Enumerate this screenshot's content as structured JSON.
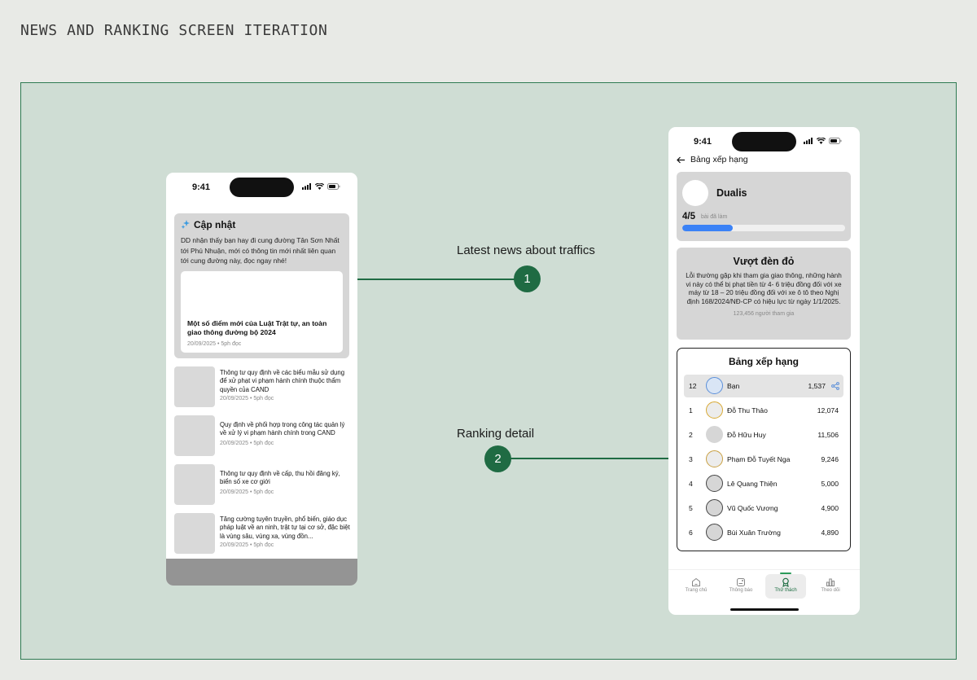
{
  "page_title": "NEWS AND RANKING SCREEN ITERATION",
  "annotations": [
    {
      "number": "1",
      "label": "Latest news about traffics"
    },
    {
      "number": "2",
      "label": "Ranking detail"
    }
  ],
  "news_screen": {
    "status_time": "9:41",
    "update": {
      "icon": "sparkle-icon",
      "title": "Cập nhật",
      "description": "DD nhận thấy bạn hay đi cung đường Tân Sơn Nhất tới Phú Nhuận, mới có thông tin mới nhất liên quan tới cung đường này, đọc ngay nhé!",
      "featured_title": "Một số điểm mới của Luật Trật tự, an toàn giao thông đường bộ 2024",
      "featured_meta": "20/09/2025  •  5ph đọc"
    },
    "news_items": [
      {
        "title": "Thông tư quy định về các biểu mẫu sử dụng để xử phạt vi phạm hành chính thuộc thẩm quyền của CAND",
        "meta": "20/09/2025  •  5ph đọc"
      },
      {
        "title": "Quy định về phối hợp trong công tác quản lý về xử lý vi phạm hành chính trong CAND",
        "meta": "20/09/2025  •  5ph đọc"
      },
      {
        "title": "Thông tư quy định về cấp, thu hồi đăng ký, biển số xe cơ giới",
        "meta": "20/09/2025  •  5ph đọc"
      },
      {
        "title": "Tăng cường tuyên truyền, phổ biến, giáo dục pháp luật về an ninh, trật tự tại cơ sở, đặc biệt là vùng sâu, vùng xa, vùng đồn...",
        "meta": "20/09/2025  •  5ph đọc"
      }
    ]
  },
  "ranking_screen": {
    "status_time": "9:41",
    "back_label": "Bảng xếp hạng",
    "profile": {
      "name": "Dualis",
      "progress_count": "4/5",
      "progress_caption": "bài đã làm",
      "progress_fraction": 0.31
    },
    "challenge": {
      "title": "Vượt đèn đỏ",
      "description": "Lỗi thường gặp khi tham gia giao thông, những hành vi này có thể bị phạt tiền từ 4- 6 triệu đồng đối với xe máy từ 18 – 20 triệu đồng đối với xe ô tô theo Nghị định 168/2024/NĐ-CP có hiệu lực từ ngày 1/1/2025.",
      "participants": "123,456 người tham gia"
    },
    "leaderboard": {
      "title": "Bảng xếp hạng",
      "rows": [
        {
          "rank": "12",
          "name": "Bạn",
          "score": "1,537",
          "ring": "#5b8fd9",
          "fill": "#d9e5f5",
          "me": true
        },
        {
          "rank": "1",
          "name": "Đỗ Thu Thảo",
          "score": "12,074",
          "ring": "#d8a831",
          "fill": "#ececec"
        },
        {
          "rank": "2",
          "name": "Đỗ Hữu Huy",
          "score": "11,506",
          "ring": "#d6d6d6",
          "fill": "#d6d6d6"
        },
        {
          "rank": "3",
          "name": "Phạm Đỗ Tuyết Nga",
          "score": "9,246",
          "ring": "#c9a043",
          "fill": "#ececec"
        },
        {
          "rank": "4",
          "name": "Lê Quang Thiện",
          "score": "5,000",
          "ring": "#444444",
          "fill": "#d6d6d6"
        },
        {
          "rank": "5",
          "name": "Vũ Quốc Vương",
          "score": "4,900",
          "ring": "#444444",
          "fill": "#d6d6d6"
        },
        {
          "rank": "6",
          "name": "Bùi Xuân Trường",
          "score": "4,890",
          "ring": "#444444",
          "fill": "#d6d6d6"
        }
      ]
    },
    "tabs": [
      {
        "label": "Trang chủ",
        "icon": "home-icon"
      },
      {
        "label": "Thông báo",
        "icon": "notification-icon"
      },
      {
        "label": "Thử thách",
        "icon": "challenge-icon",
        "active": true
      },
      {
        "label": "Theo dõi",
        "icon": "stats-icon"
      }
    ]
  },
  "colors": {
    "canvas": "#cfddd4",
    "accent": "#1f6b43",
    "progress": "#3b82f6"
  }
}
